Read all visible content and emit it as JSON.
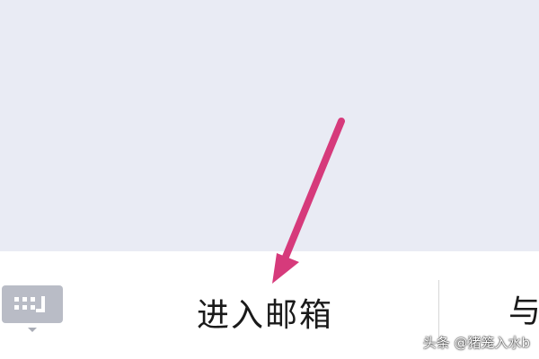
{
  "bottom_menu": {
    "keyboard_toggle_icon": "keyboard-icon",
    "mailbox_label": "进入邮箱",
    "next_item_label": "与"
  },
  "watermark": {
    "text": "头条 @猪笼入水b"
  },
  "colors": {
    "content_background": "#e9ebf4",
    "bar_background": "#ffffff",
    "keyboard_button": "#b9bcc6",
    "annotation_arrow": "#d63a7b",
    "label_text": "#1a1a1a"
  }
}
